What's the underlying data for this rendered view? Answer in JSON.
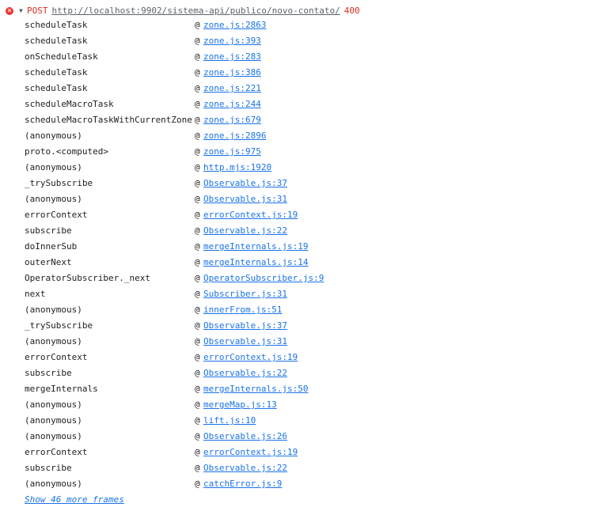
{
  "request": {
    "icon": "error-circle-icon",
    "arrow": "▼",
    "method": "POST",
    "url": "http://localhost:9902/sistema-api/publico/novo-contato/",
    "status": "400"
  },
  "frames": [
    {
      "fn": "scheduleTask",
      "at": "@",
      "src": "zone.js:2863"
    },
    {
      "fn": "scheduleTask",
      "at": "@",
      "src": "zone.js:393"
    },
    {
      "fn": "onScheduleTask",
      "at": "@",
      "src": "zone.js:283"
    },
    {
      "fn": "scheduleTask",
      "at": "@",
      "src": "zone.js:386"
    },
    {
      "fn": "scheduleTask",
      "at": "@",
      "src": "zone.js:221"
    },
    {
      "fn": "scheduleMacroTask",
      "at": "@",
      "src": "zone.js:244"
    },
    {
      "fn": "scheduleMacroTaskWithCurrentZone",
      "at": "@",
      "src": "zone.js:679"
    },
    {
      "fn": "(anonymous)",
      "at": "@",
      "src": "zone.js:2896"
    },
    {
      "fn": "proto.<computed>",
      "at": "@",
      "src": "zone.js:975"
    },
    {
      "fn": "(anonymous)",
      "at": "@",
      "src": "http.mjs:1920"
    },
    {
      "fn": "_trySubscribe",
      "at": "@",
      "src": "Observable.js:37"
    },
    {
      "fn": "(anonymous)",
      "at": "@",
      "src": "Observable.js:31"
    },
    {
      "fn": "errorContext",
      "at": "@",
      "src": "errorContext.js:19"
    },
    {
      "fn": "subscribe",
      "at": "@",
      "src": "Observable.js:22"
    },
    {
      "fn": "doInnerSub",
      "at": "@",
      "src": "mergeInternals.js:19"
    },
    {
      "fn": "outerNext",
      "at": "@",
      "src": "mergeInternals.js:14"
    },
    {
      "fn": "OperatorSubscriber._next",
      "at": "@",
      "src": "OperatorSubscriber.js:9"
    },
    {
      "fn": "next",
      "at": "@",
      "src": "Subscriber.js:31"
    },
    {
      "fn": "(anonymous)",
      "at": "@",
      "src": "innerFrom.js:51"
    },
    {
      "fn": "_trySubscribe",
      "at": "@",
      "src": "Observable.js:37"
    },
    {
      "fn": "(anonymous)",
      "at": "@",
      "src": "Observable.js:31"
    },
    {
      "fn": "errorContext",
      "at": "@",
      "src": "errorContext.js:19"
    },
    {
      "fn": "subscribe",
      "at": "@",
      "src": "Observable.js:22"
    },
    {
      "fn": "mergeInternals",
      "at": "@",
      "src": "mergeInternals.js:50"
    },
    {
      "fn": "(anonymous)",
      "at": "@",
      "src": "mergeMap.js:13"
    },
    {
      "fn": "(anonymous)",
      "at": "@",
      "src": "lift.js:10"
    },
    {
      "fn": "(anonymous)",
      "at": "@",
      "src": "Observable.js:26"
    },
    {
      "fn": "errorContext",
      "at": "@",
      "src": "errorContext.js:19"
    },
    {
      "fn": "subscribe",
      "at": "@",
      "src": "Observable.js:22"
    },
    {
      "fn": "(anonymous)",
      "at": "@",
      "src": "catchError.js:9"
    }
  ],
  "more_frames_label": "Show 46 more frames",
  "colors": {
    "error": "#d93025",
    "link": "#1a73e8",
    "text": "#202124",
    "url": "#5f6368"
  }
}
